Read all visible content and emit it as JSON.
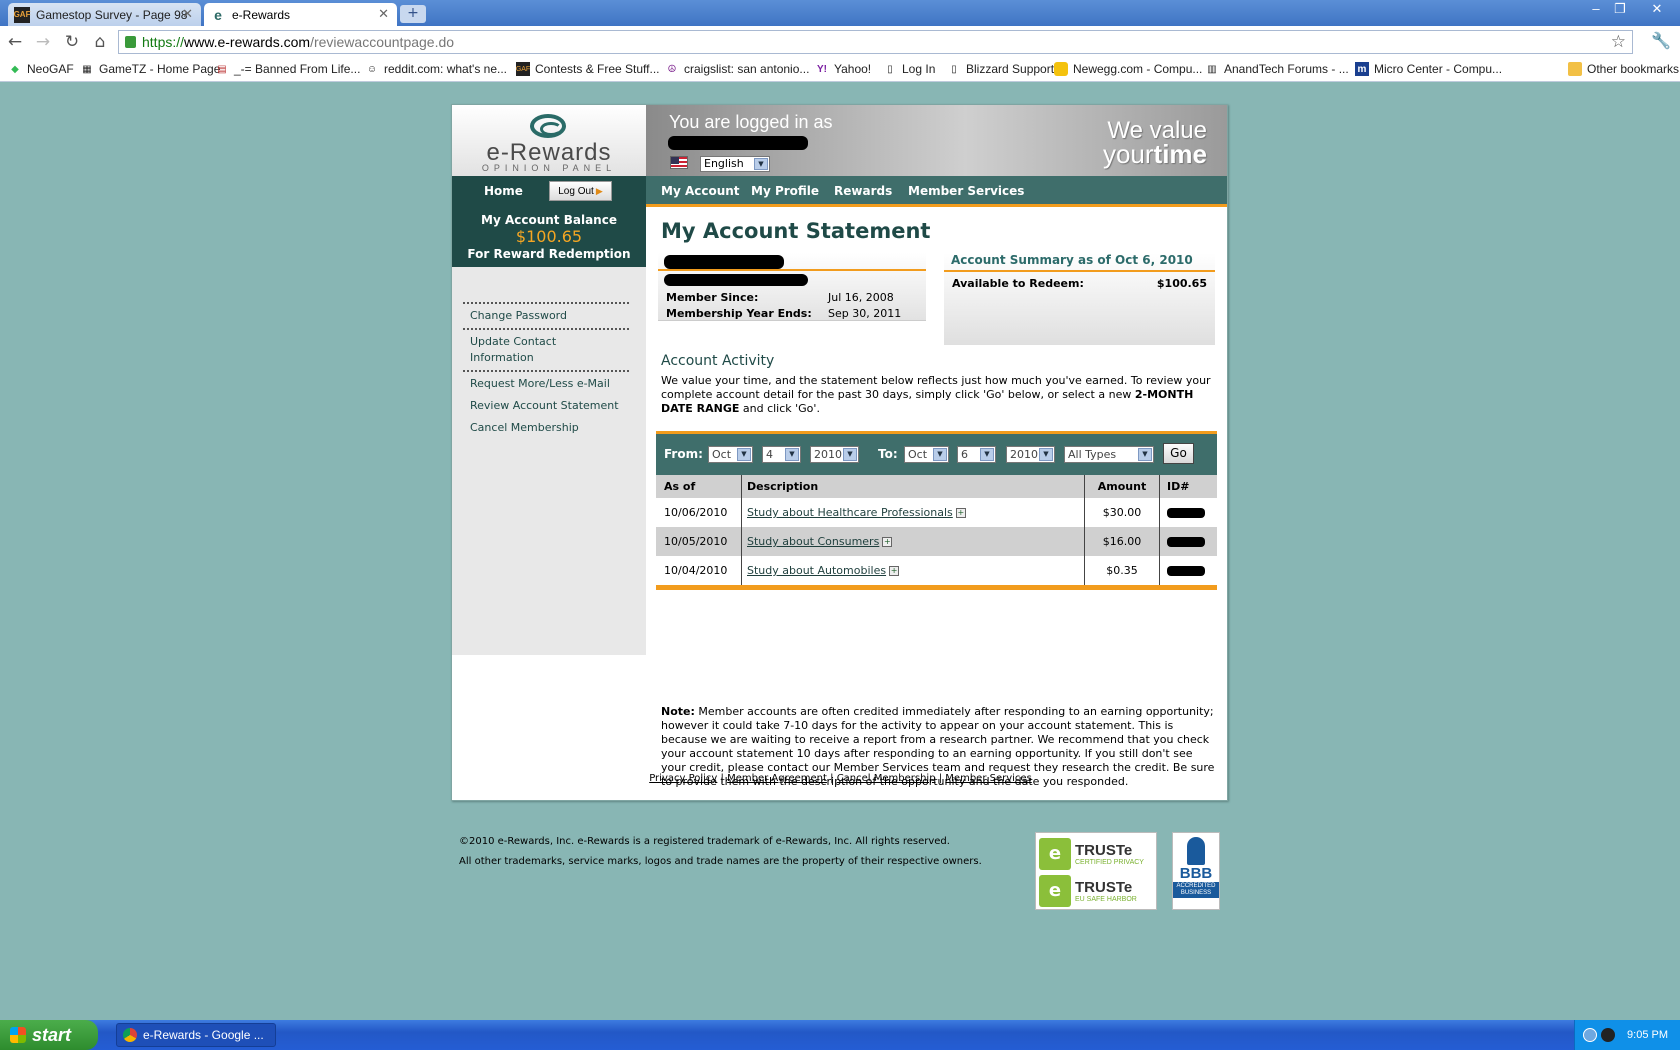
{
  "browser": {
    "tabs": [
      {
        "label": "Gamestop Survey - Page 98",
        "active": false
      },
      {
        "label": "e-Rewards",
        "active": true
      }
    ],
    "url": {
      "scheme": "https://",
      "host": "www.e-rewards.com",
      "path": "/reviewaccountpage.do"
    },
    "bookmarks": [
      "NeoGAF",
      "GameTZ - Home Page",
      "_-= Banned From Life...",
      "reddit.com: what's ne...",
      "Contests & Free Stuff...",
      "craigslist: san antonio...",
      "Yahoo!",
      "Log In",
      "Blizzard Support",
      "Newegg.com - Compu...",
      "AnandTech Forums - ...",
      "Micro Center - Compu..."
    ],
    "other_bookmarks": "Other bookmarks"
  },
  "header": {
    "logo_name": "e-Rewards",
    "logo_sub": "OPINION PANEL",
    "logged_in": "You are logged in as",
    "language": "English",
    "tagline_top": "We value",
    "tagline_your": "your",
    "tagline_time": "time"
  },
  "nav": {
    "home": "Home",
    "logout": "Log Out",
    "items": [
      "My Account",
      "My Profile",
      "Rewards",
      "Member Services"
    ]
  },
  "sidebar": {
    "balance_title": "My Account Balance",
    "balance_value": "$100.65",
    "balance_caption": "For Reward Redemption",
    "links": [
      "Change Password",
      "Update Contact Information",
      "Request More/Less e-Mail",
      "Review Account Statement",
      "Cancel Membership"
    ]
  },
  "main": {
    "title": "My Account Statement",
    "member_since_label": "Member Since:",
    "member_since": "Jul 16, 2008",
    "year_ends_label": "Membership Year Ends:",
    "year_ends": "Sep 30, 2011",
    "summary_title": "Account Summary as of Oct 6, 2010",
    "available_label": "Available to Redeem:",
    "available_value": "$100.65",
    "activity_title": "Account Activity",
    "activity_text_1": "We value your time, and the statement below reflects just how much you've earned. To review your complete account detail for the past 30 days, simply click 'Go' below, or select a new ",
    "activity_text_bold": "2-MONTH DATE RANGE",
    "activity_text_2": " and click 'Go'."
  },
  "filter": {
    "from_label": "From:",
    "to_label": "To:",
    "from_month": "Oct",
    "from_day": "4",
    "from_year": "2010",
    "to_month": "Oct",
    "to_day": "6",
    "to_year": "2010",
    "type": "All Types",
    "go": "Go"
  },
  "table": {
    "headers": [
      "As of",
      "Description",
      "Amount",
      "ID#"
    ],
    "rows": [
      {
        "date": "10/06/2010",
        "desc": "Study about Healthcare Professionals",
        "amount": "$30.00"
      },
      {
        "date": "10/05/2010",
        "desc": "Study about Consumers",
        "amount": "$16.00"
      },
      {
        "date": "10/04/2010",
        "desc": "Study about Automobiles",
        "amount": "$0.35"
      }
    ]
  },
  "note": {
    "label": "Note:",
    "text": " Member accounts are often credited immediately after responding to an earning opportunity; however it could take 7-10 days for the activity to appear on your account statement. This is because we are waiting to receive a report from a research partner. We recommend that you check your account statement 10 days after responding to an earning opportunity. If you still don't see your credit, please contact our Member Services team and request they research the credit. Be sure to provide them with the description of the opportunity and the date you responded."
  },
  "footer": {
    "links": [
      "Privacy Policy",
      "Member Agreement",
      "Cancel Membership",
      "Member Services"
    ],
    "copyright_1": "©2010 e-Rewards, Inc. e-Rewards is a registered trademark of e-Rewards, Inc. All rights reserved.",
    "copyright_2": "All other trademarks, service marks, logos and trade names are the property of their respective owners.",
    "truste_name": "TRUSTe",
    "truste_1": "CERTIFIED PRIVACY",
    "truste_2": "EU SAFE HARBOR",
    "bbb": "BBB",
    "bbb_sub": "ACCREDITED BUSINESS"
  },
  "taskbar": {
    "start": "start",
    "task": "e-Rewards - Google ...",
    "clock": "9:05 PM"
  },
  "colors": {
    "page_bg": "#88b6b4",
    "brand_dark": "#1f4a47",
    "brand_mid": "#3f6e6b",
    "accent_orange": "#f29c1d"
  }
}
